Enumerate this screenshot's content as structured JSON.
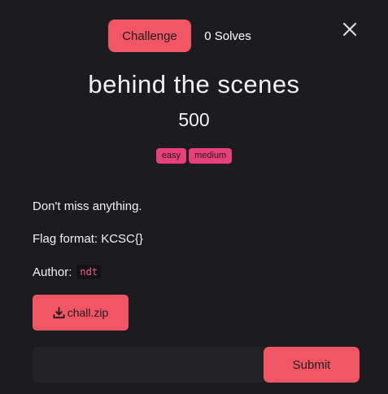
{
  "header": {
    "tab_challenge": "Challenge",
    "tab_solves": "0 Solves",
    "close_icon": "close-icon"
  },
  "challenge": {
    "name": "behind the scenes",
    "points": "500",
    "tags": [
      "easy",
      "medium"
    ],
    "description": [
      "Don't miss anything.",
      "Flag format: KCSC{}"
    ],
    "author_label": "Author:",
    "author_name": "ndt",
    "file_name": "chall.zip",
    "file_icon": "download-icon"
  },
  "form": {
    "flag_value": "",
    "flag_placeholder": "",
    "submit_label": "Submit"
  },
  "colors": {
    "background": "#1c1c20",
    "accent": "#f25564",
    "tag": "#e8417a",
    "input_bg": "#232326",
    "code_text": "#f25c8a"
  }
}
